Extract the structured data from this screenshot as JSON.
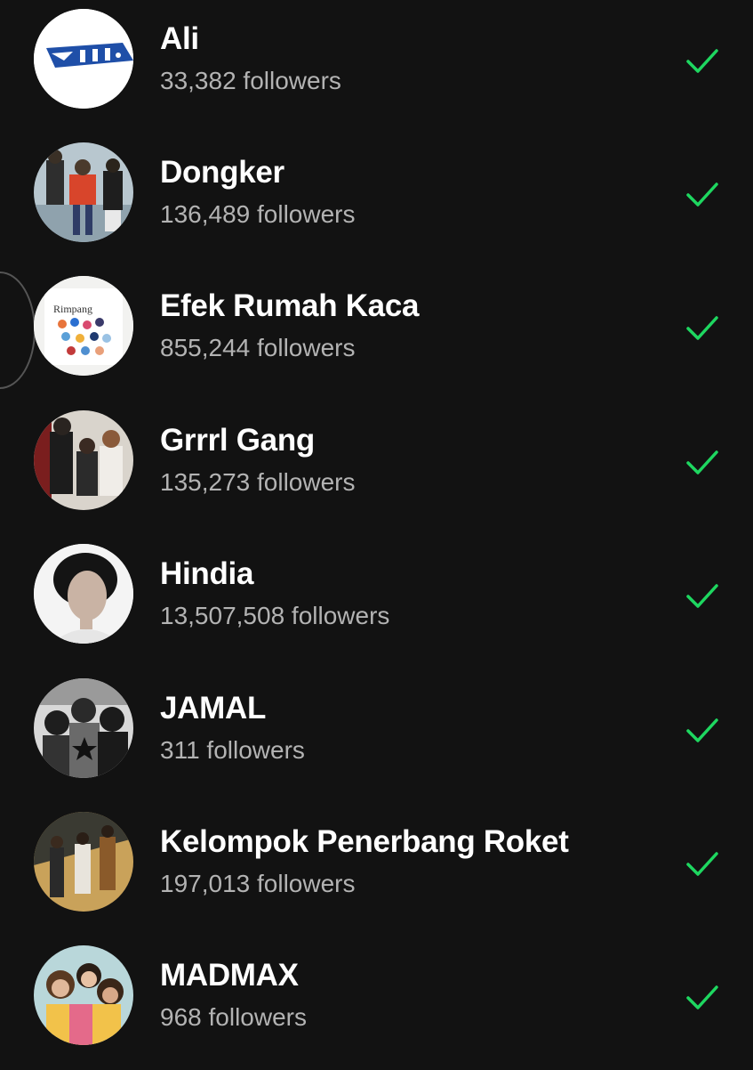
{
  "following": {
    "items": [
      {
        "name": "Ali",
        "followers": "33,382 followers"
      },
      {
        "name": "Dongker",
        "followers": "136,489 followers"
      },
      {
        "name": "Efek Rumah Kaca",
        "followers": "855,244 followers",
        "cover_text": "Rimpang"
      },
      {
        "name": "Grrrl Gang",
        "followers": "135,273 followers"
      },
      {
        "name": "Hindia",
        "followers": "13,507,508 followers"
      },
      {
        "name": "JAMAL",
        "followers": "311 followers"
      },
      {
        "name": "Kelompok Penerbang Roket",
        "followers": "197,013 followers"
      },
      {
        "name": "MADMAX",
        "followers": "968 followers"
      }
    ]
  },
  "icons": {
    "followed": "checkmark-icon",
    "ali_logo": "ali-logo"
  },
  "colors": {
    "background": "#121212",
    "name_text": "#ffffff",
    "secondary_text": "#b3b3b3",
    "check": "#1ed760"
  }
}
